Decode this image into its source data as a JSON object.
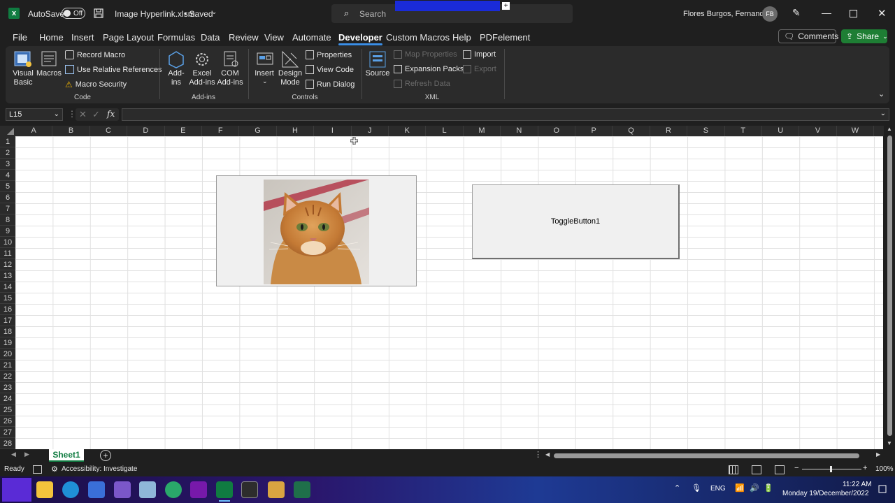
{
  "titlebar": {
    "autosave_label": "AutoSave",
    "autosave_state": "Off",
    "filename": "Image Hyperlink.xlsm",
    "saved_state": "• Saved",
    "search_placeholder": "Search",
    "user_name": "Flores Burgos, Fernando",
    "avatar_initials": "FB"
  },
  "menu": {
    "tabs": [
      "File",
      "Home",
      "Insert",
      "Page Layout",
      "Formulas",
      "Data",
      "Review",
      "View",
      "Automate",
      "Developer",
      "Custom Macros",
      "Help",
      "PDFelement"
    ],
    "active": "Developer",
    "comments_label": "Comments",
    "share_label": "Share"
  },
  "ribbon": {
    "code": {
      "group": "Code",
      "visual_basic": "Visual\nBasic",
      "macros": "Macros",
      "record_macro": "Record Macro",
      "relative_refs": "Use Relative References",
      "macro_security": "Macro Security"
    },
    "addins": {
      "group": "Add-ins",
      "addins": "Add-\nins",
      "excel_addins": "Excel\nAdd-ins",
      "com_addins": "COM\nAdd-ins"
    },
    "controls": {
      "group": "Controls",
      "insert": "Insert",
      "design_mode": "Design\nMode",
      "properties": "Properties",
      "view_code": "View Code",
      "run_dialog": "Run Dialog"
    },
    "xml": {
      "group": "XML",
      "source": "Source",
      "map_properties": "Map Properties",
      "expansion_packs": "Expansion Packs",
      "refresh_data": "Refresh Data",
      "import": "Import",
      "export": "Export"
    }
  },
  "formula_bar": {
    "name_box": "L15",
    "fx_label": "fx",
    "formula": ""
  },
  "grid": {
    "columns": [
      "A",
      "B",
      "C",
      "D",
      "E",
      "F",
      "G",
      "H",
      "I",
      "J",
      "K",
      "L",
      "M",
      "N",
      "O",
      "P",
      "Q",
      "R",
      "S",
      "T",
      "U",
      "V",
      "W"
    ],
    "rows": [
      "1",
      "2",
      "3",
      "4",
      "5",
      "6",
      "7",
      "8",
      "9",
      "10",
      "11",
      "12",
      "13",
      "14",
      "15",
      "16",
      "17",
      "18",
      "19",
      "20",
      "21",
      "22",
      "23",
      "24",
      "25",
      "26",
      "27",
      "28"
    ]
  },
  "objects": {
    "toggle_button_caption": "ToggleButton1",
    "image_subject": "orange-tabby-cat-photo"
  },
  "sheets": {
    "active": "Sheet1"
  },
  "status": {
    "ready": "Ready",
    "accessibility": "Accessibility: Investigate",
    "zoom": "100%"
  },
  "taskbar": {
    "lang": "ENG",
    "time": "11:22 AM",
    "date": "Monday 19/December/2022"
  },
  "colors": {
    "excel_green": "#107c41",
    "active_tab_underline": "#3a8ee6",
    "share_button": "#1e7e34"
  }
}
